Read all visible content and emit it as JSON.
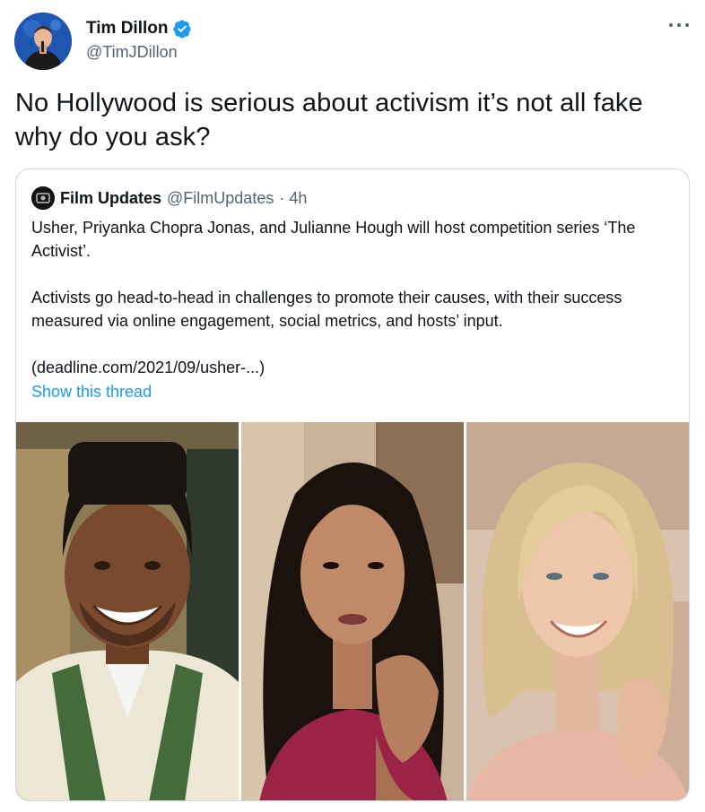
{
  "author": {
    "name": "Tim Dillon",
    "handle": "@TimJDillon",
    "verified": true
  },
  "tweet": {
    "text": "No Hollywood is serious about activism it’s not all fake why do you ask?"
  },
  "quote": {
    "name": "Film Updates",
    "handle": "@FilmUpdates",
    "time": "· 4h",
    "paragraph1": "Usher, Priyanka Chopra Jonas, and Julianne Hough will host competition series ‘The Activist’.",
    "paragraph2": "Activists go head-to-head in challenges to promote their causes, with their success measured via online engagement, social metrics, and hosts’ input.",
    "paragraph3": "(deadline.com/2021/09/usher-...)",
    "thread_link": "Show this thread"
  },
  "icons": {
    "verified": "verified-badge-icon",
    "more": "more-options-icon"
  },
  "colors": {
    "link": "#1d9bf0",
    "secondary_text": "#536471",
    "border": "#cfd9de"
  }
}
